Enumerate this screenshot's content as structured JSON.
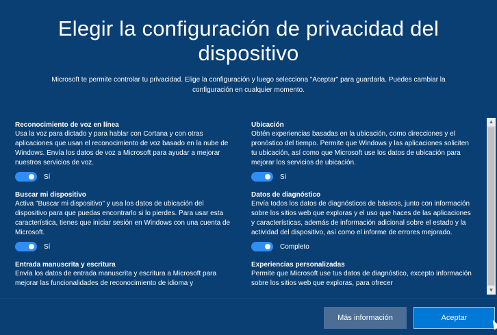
{
  "page": {
    "title": "Elegir la configuración de privacidad del dispositivo",
    "subtitle": "Microsoft te permite controlar tu privacidad. Elige la configuración y luego selecciona \"Aceptar\" para guardarla. Puedes cambiar la configuración en cualquier momento."
  },
  "settings_left": [
    {
      "title": "Reconocimiento de voz en línea",
      "description": "Usa la voz para dictado y para hablar con Cortana y con otras aplicaciones que usan el reconocimiento de voz basado en la nube de Windows. Envía los datos de voz a Microsoft para ayudar a mejorar nuestros servicios de voz.",
      "toggle_label": "Sí",
      "enabled": true
    },
    {
      "title": "Buscar mi dispositivo",
      "description": "Activa \"Buscar mi dispositivo\" y usa los datos de ubicación del dispositivo para que puedas encontrarlo si lo pierdes. Para usar esta característica, tienes que iniciar sesión en Windows con una cuenta de Microsoft.",
      "toggle_label": "Sí",
      "enabled": true
    },
    {
      "title": "Entrada manuscrita y escritura",
      "description": "Envía los datos de entrada manuscrita y escritura a Microsoft para mejorar las funcionalidades de reconocimiento de idioma y"
    }
  ],
  "settings_right": [
    {
      "title": "Ubicación",
      "description": "Obtén experiencias basadas en la ubicación, como direcciones y el pronóstico del tiempo. Permite que Windows y las aplicaciones soliciten tu ubicación, así como que Microsoft use los datos de ubicación para mejorar los servicios de ubicación.",
      "toggle_label": "Sí",
      "enabled": true
    },
    {
      "title": "Datos de diagnóstico",
      "description": "Envía todos los datos de diagnósticos de básicos, junto con información sobre los sitios web que exploras y el uso que haces de las aplicaciones y características, además de información adicional sobre el estado y la actividad del dispositivo, así como el informe de errores mejorado.",
      "toggle_label": "Completo",
      "enabled": true
    },
    {
      "title": "Experiencias personalizadas",
      "description": "Permite que Microsoft use tus datos de diagnóstico, excepto información sobre los sitios web que exploras, para ofrecer"
    }
  ],
  "buttons": {
    "more_info": "Más información",
    "accept": "Aceptar"
  },
  "colors": {
    "background": "#0a3f73",
    "toggle_on": "#2f8ef6",
    "accent_button": "#0078d7"
  }
}
